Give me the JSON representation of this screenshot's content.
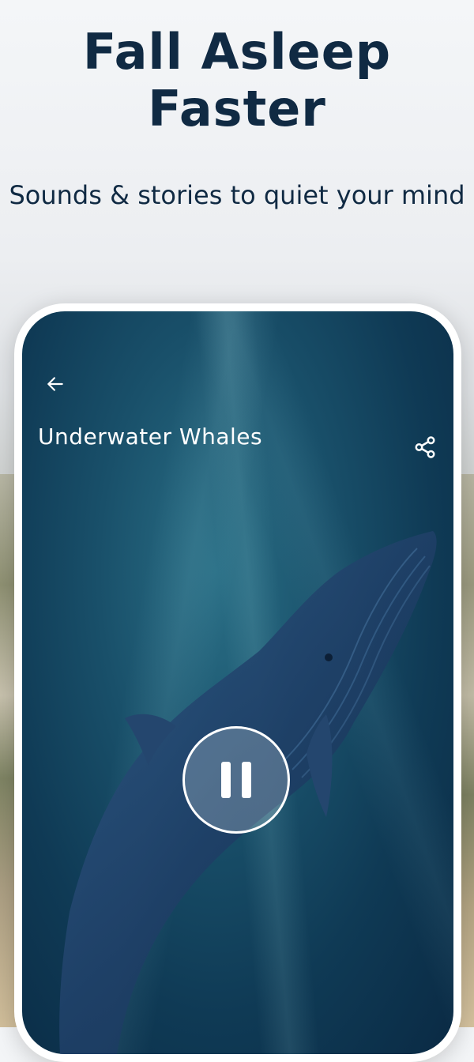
{
  "promo": {
    "headline": "Fall Asleep Faster",
    "subtitle": "Sounds & stories to quiet your mind"
  },
  "player": {
    "title": "Underwater Whales",
    "state": "playing",
    "icons": {
      "back": "arrow-left-icon",
      "share": "share-icon",
      "pause": "pause-icon"
    }
  },
  "colors": {
    "heading_text": "#102a43",
    "screen_background": "#0f3a55",
    "control_foreground": "#ffffff"
  }
}
